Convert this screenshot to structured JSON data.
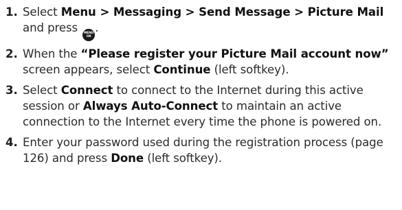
{
  "steps": [
    {
      "number": "1.",
      "parts": {
        "t1": "Select ",
        "b1": "Menu > Messaging > Send Message > Picture Mail",
        "t2": " and press ",
        "t3": "."
      },
      "key": {
        "top": "MENU",
        "bottom": "OK"
      }
    },
    {
      "number": "2.",
      "parts": {
        "t1": "When the ",
        "b1": "“Please register your Picture Mail account now”",
        "t2": " screen appears, select ",
        "b2": "Continue",
        "t3": " (left softkey)."
      }
    },
    {
      "number": "3.",
      "parts": {
        "t1": "Select ",
        "b1": "Connect",
        "t2": " to connect to the Internet during this active session or ",
        "b2": "Always Auto-Connect",
        "t3": " to maintain an active connection to the Internet every time the phone is powered on."
      }
    },
    {
      "number": "4.",
      "parts": {
        "t1": "Enter your password used during the registration process (page 126) and press ",
        "b1": "Done",
        "t2": " (left softkey)."
      }
    }
  ]
}
